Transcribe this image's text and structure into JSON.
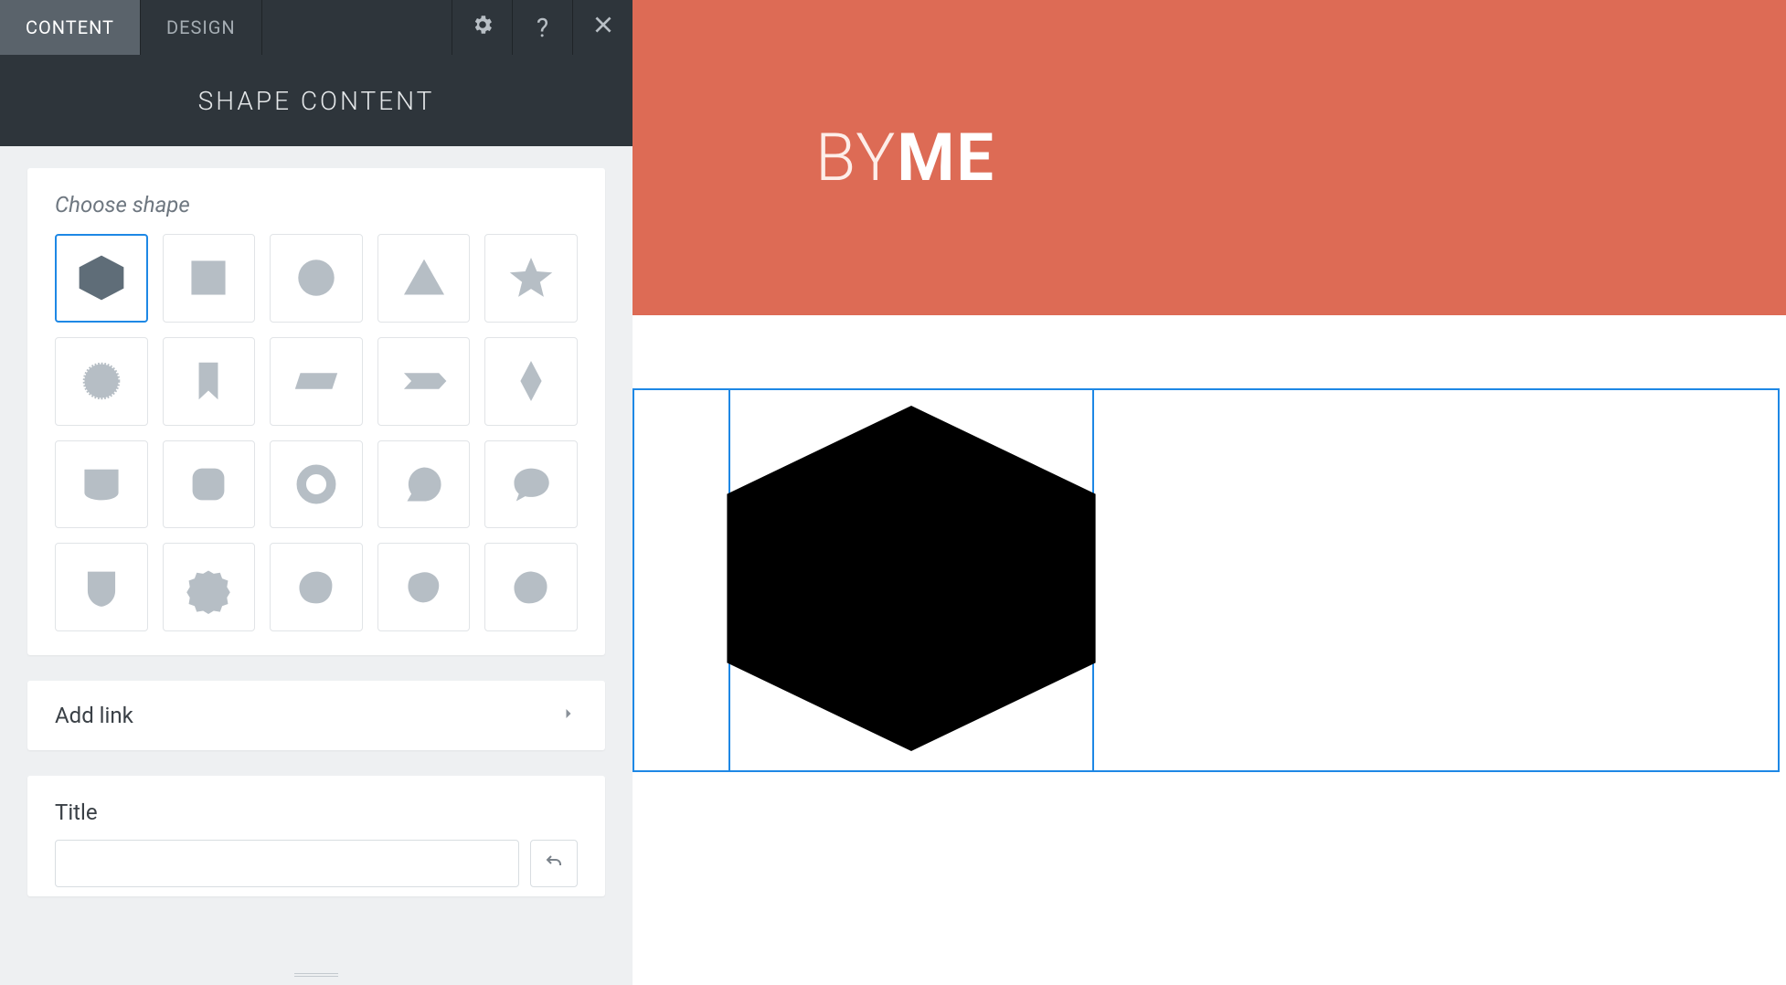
{
  "tabs": {
    "content": "CONTENT",
    "design": "DESIGN"
  },
  "panel": {
    "title": "SHAPE CONTENT",
    "choose_shape": "Choose shape",
    "add_link": "Add link",
    "title_label": "Title"
  },
  "shapes": [
    {
      "name": "hexagon",
      "selected": true
    },
    {
      "name": "square",
      "selected": false
    },
    {
      "name": "circle",
      "selected": false
    },
    {
      "name": "triangle",
      "selected": false
    },
    {
      "name": "star",
      "selected": false
    },
    {
      "name": "burst",
      "selected": false
    },
    {
      "name": "bookmark",
      "selected": false
    },
    {
      "name": "parallelogram",
      "selected": false
    },
    {
      "name": "arrow-banner",
      "selected": false
    },
    {
      "name": "diamond",
      "selected": false
    },
    {
      "name": "tab-down",
      "selected": false
    },
    {
      "name": "rounded-square",
      "selected": false
    },
    {
      "name": "ring",
      "selected": false
    },
    {
      "name": "speech-drop",
      "selected": false
    },
    {
      "name": "speech-bubble",
      "selected": false
    },
    {
      "name": "shield",
      "selected": false
    },
    {
      "name": "badge",
      "selected": false
    },
    {
      "name": "blob1",
      "selected": false
    },
    {
      "name": "blob2",
      "selected": false
    },
    {
      "name": "blob3",
      "selected": false
    }
  ],
  "canvas": {
    "brand_light": "BY",
    "brand_bold": "ME",
    "header_color": "#dd6b55",
    "selected_shape": "hexagon",
    "shape_color": "#000000"
  }
}
